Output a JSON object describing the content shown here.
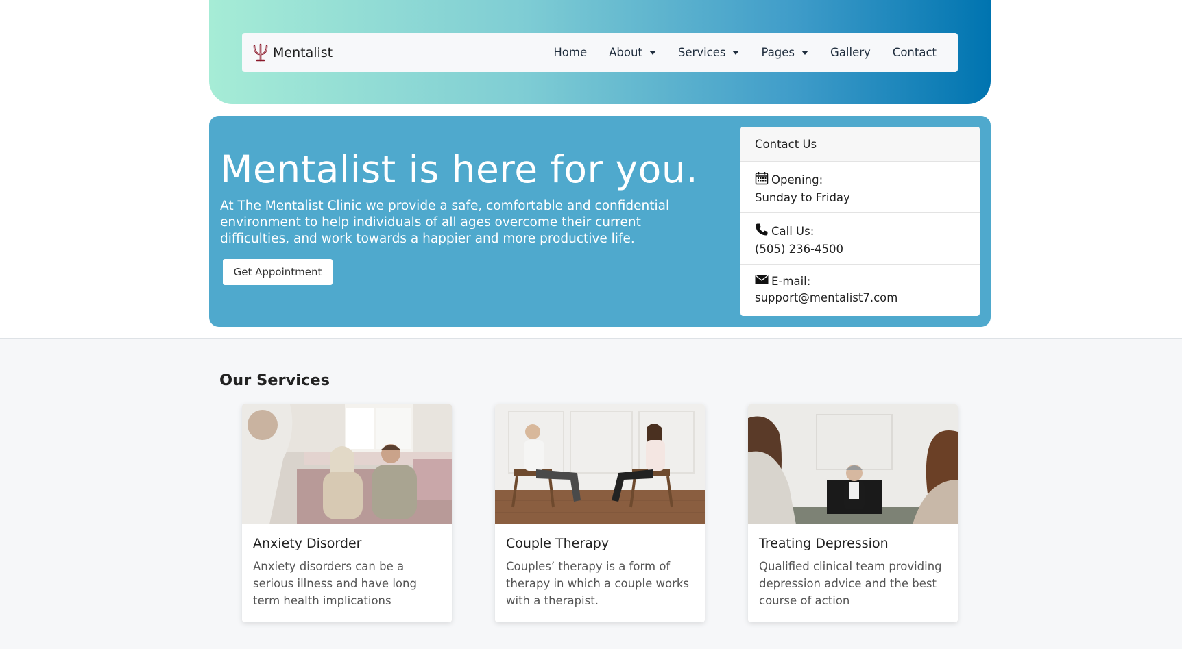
{
  "nav": {
    "brand": "Mentalist",
    "links": [
      {
        "label": "Home"
      },
      {
        "label": "About"
      },
      {
        "label": "Services"
      },
      {
        "label": "Pages"
      },
      {
        "label": "Gallery"
      },
      {
        "label": "Contact"
      }
    ]
  },
  "hero": {
    "title": "Mentalist is here for you.",
    "text": "At The Mentalist Clinic we provide a safe, comfortable and confidential environment to help individuals of all ages overcome their current difficulties, and work towards a happier and more productive life.",
    "button": "Get Appointment"
  },
  "contact": {
    "header": "Contact Us",
    "opening_label": "Opening:",
    "opening_value": "Sunday to Friday",
    "call_label": "Call Us:",
    "call_value": "(505) 236-4500",
    "email_label": "E-mail:",
    "email_value": "support@mentalist7.com"
  },
  "services": {
    "title": "Our Services",
    "cards": [
      {
        "title": "Anxiety Disorder",
        "text": "Anxiety disorders can be a serious illness and have long term health implications"
      },
      {
        "title": "Couple Therapy",
        "text": "Couples’ therapy is a form of therapy in which a couple works with a therapist."
      },
      {
        "title": "Treating Depression",
        "text": "Qualified clinical team providing depression advice and the best course of action"
      }
    ]
  },
  "colors": {
    "hero_bg": "#4fa9cd",
    "brand_icon": "#8b1a2b",
    "header_gradient_start": "#a6ecd6",
    "header_gradient_end": "#0074b0"
  }
}
